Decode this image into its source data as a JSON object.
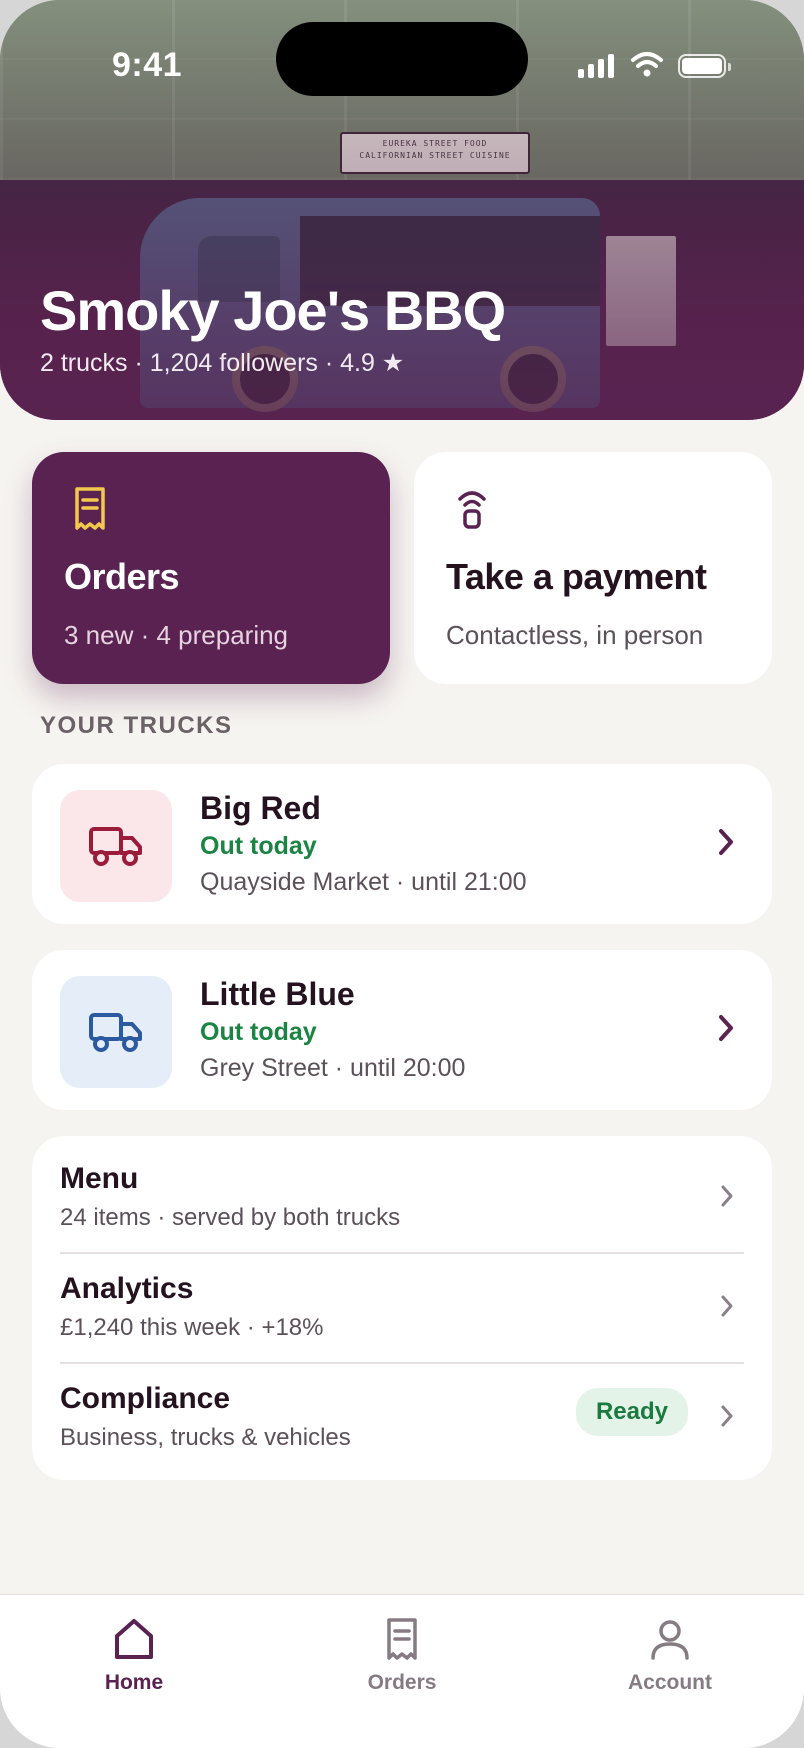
{
  "status_bar": {
    "time": "9:41"
  },
  "hero": {
    "title": "Smoky Joe's BBQ",
    "subtitle": "2 trucks · 1,204 followers · 4.9 ★"
  },
  "actions": {
    "orders": {
      "title": "Orders",
      "subtitle": "3 new · 4 preparing",
      "icon": "receipt-icon"
    },
    "payment": {
      "title": "Take a payment",
      "subtitle": "Contactless, in person",
      "icon": "contactless-icon"
    }
  },
  "trucks_section": {
    "label": "YOUR TRUCKS",
    "items": [
      {
        "name": "Big Red",
        "status": "Out today",
        "location": "Quayside Market · until 21:00",
        "icon": "truck-icon",
        "color": "#9b1b3a",
        "bg": "#fbe6e9"
      },
      {
        "name": "Little Blue",
        "status": "Out today",
        "location": "Grey Street · until 20:00",
        "icon": "truck-icon",
        "color": "#2c5aa0",
        "bg": "#e4edf8"
      }
    ]
  },
  "manage": {
    "items": [
      {
        "title": "Menu",
        "subtitle": "24 items · served by both trucks"
      },
      {
        "title": "Analytics",
        "subtitle": "£1,240 this week · +18%"
      },
      {
        "title": "Compliance",
        "subtitle": "Business, trucks & vehicles",
        "badge": "Ready"
      }
    ]
  },
  "tabbar": {
    "items": [
      {
        "label": "Home",
        "icon": "home-icon",
        "active": true
      },
      {
        "label": "Orders",
        "icon": "receipt-icon",
        "active": false
      },
      {
        "label": "Account",
        "icon": "person-icon",
        "active": false
      }
    ]
  },
  "colors": {
    "brand": "#5a2250",
    "success": "#1a8443",
    "background": "#f6f4f1"
  }
}
